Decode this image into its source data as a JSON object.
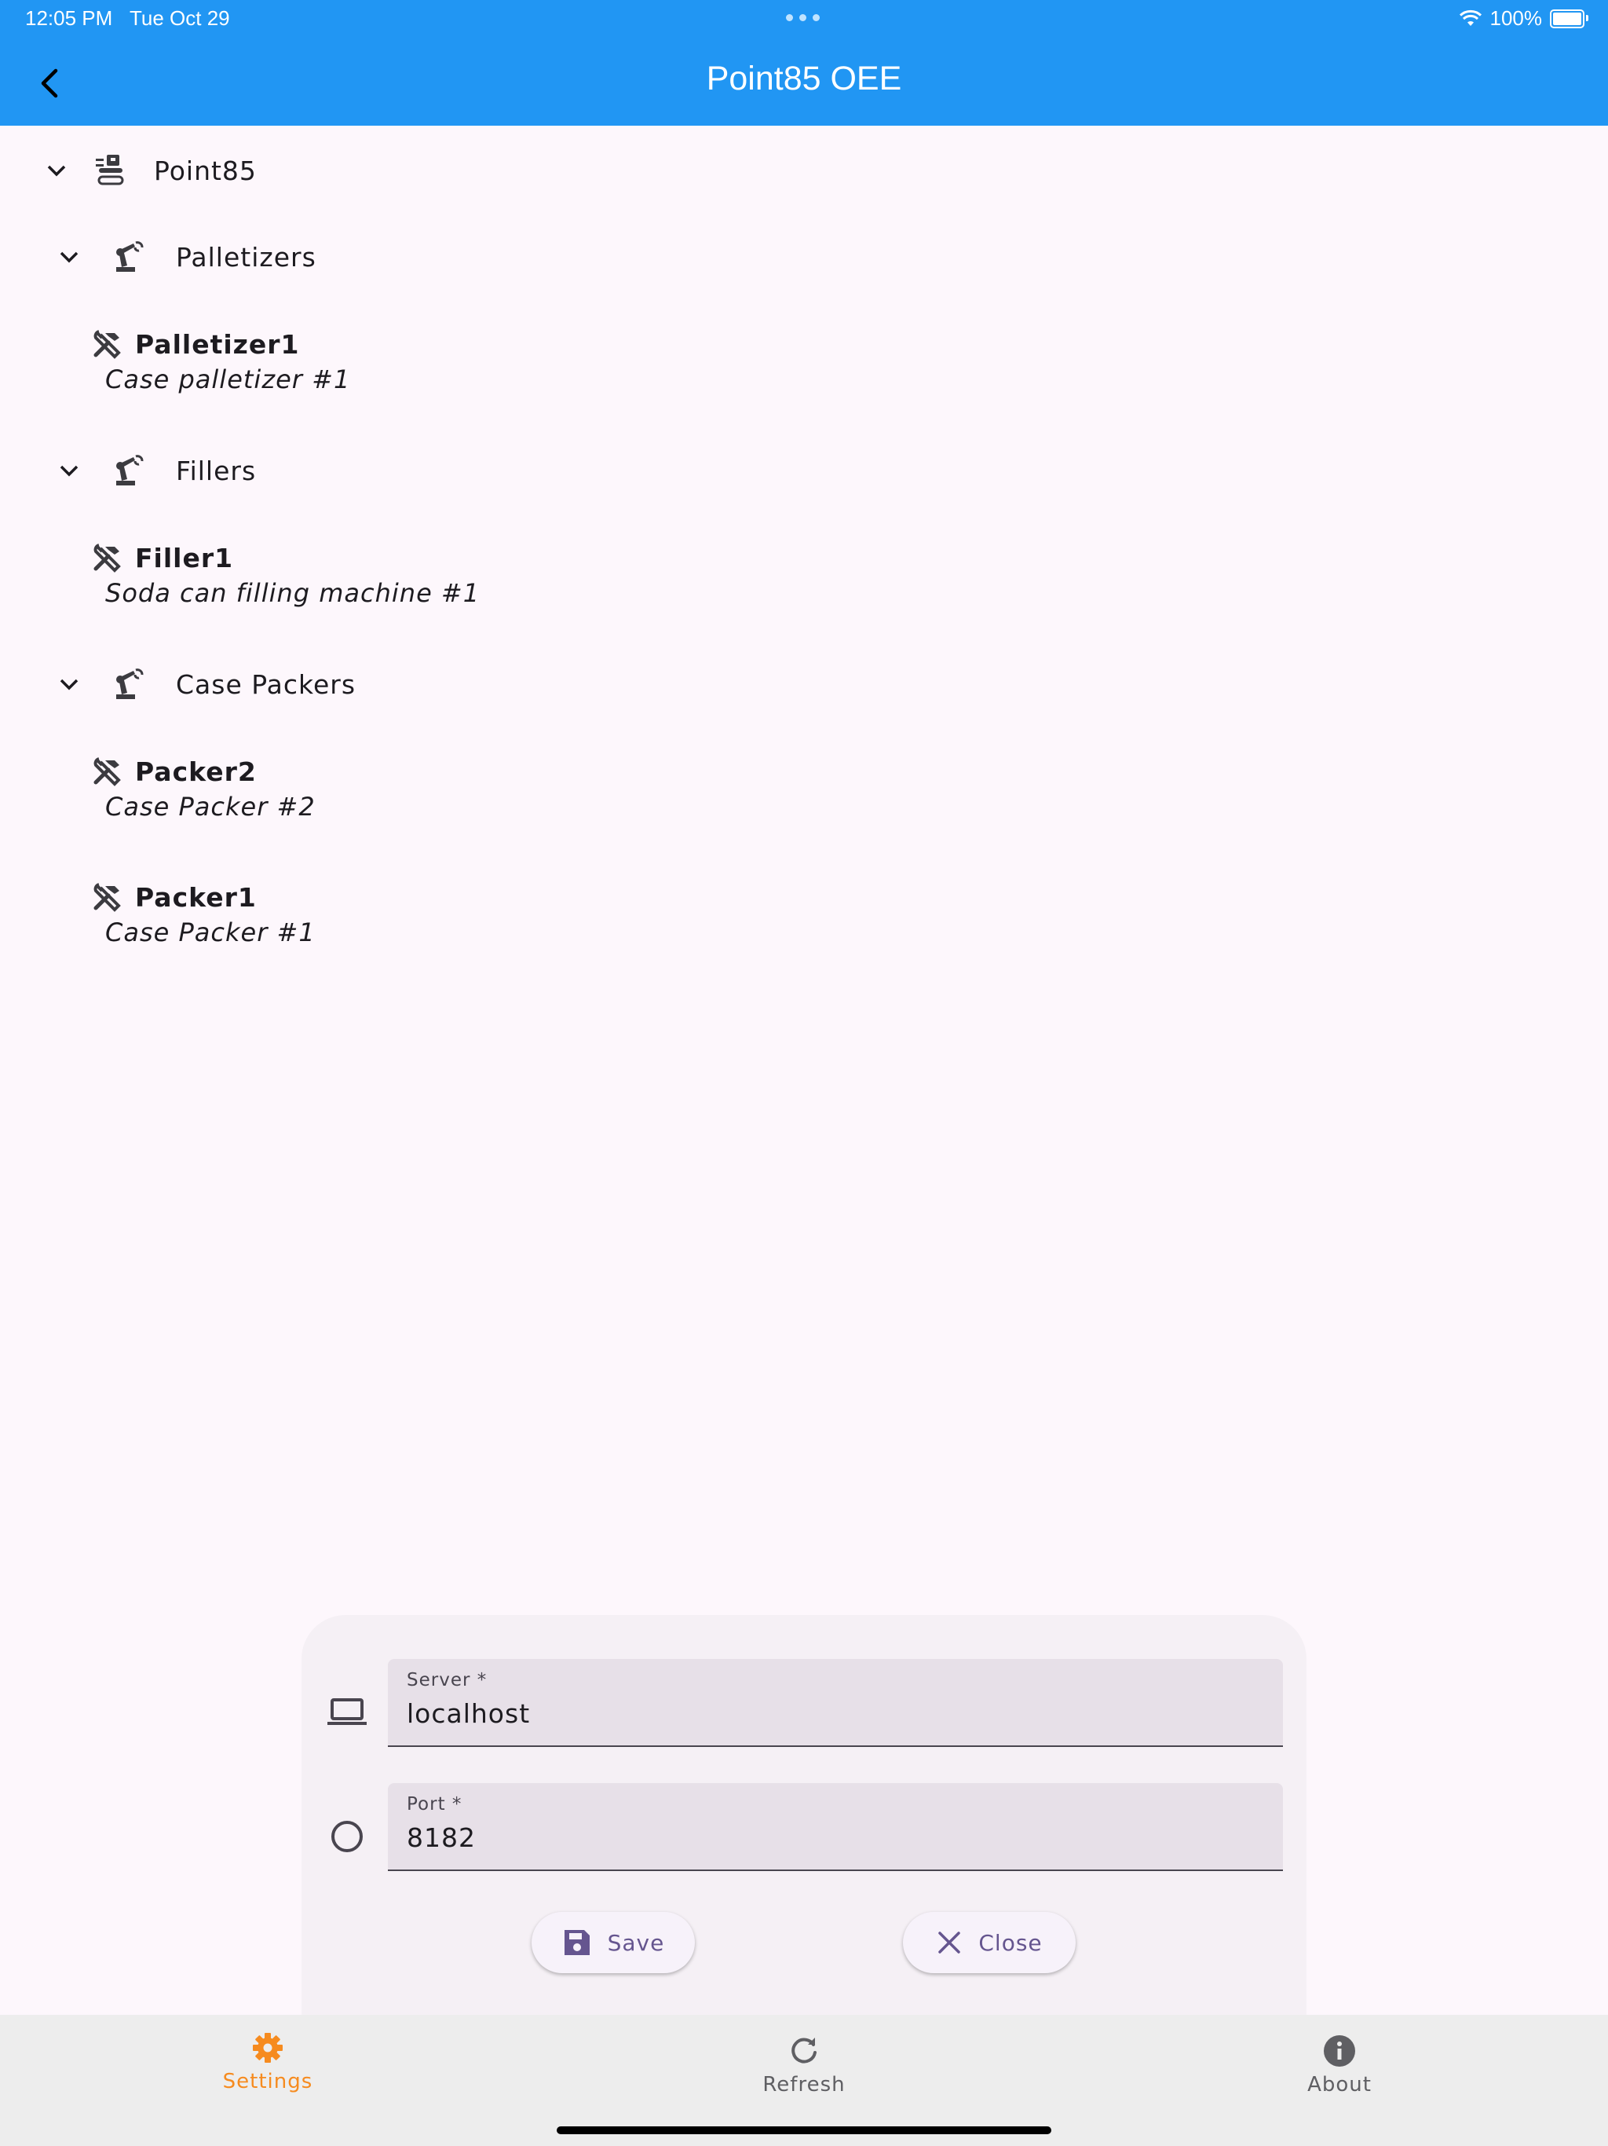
{
  "status_bar": {
    "time": "12:05 PM",
    "date": "Tue Oct 29",
    "battery": "100%"
  },
  "app_bar": {
    "title": "Point85 OEE"
  },
  "tree": {
    "root": {
      "label": "Point85",
      "icon": "production-line-icon"
    },
    "groups": [
      {
        "label": "Palletizers",
        "icon": "robot-arm-icon",
        "items": [
          {
            "name": "Palletizer1",
            "description": "Case palletizer #1"
          }
        ]
      },
      {
        "label": "Fillers",
        "icon": "robot-arm-icon",
        "items": [
          {
            "name": "Filler1",
            "description": "Soda can filling machine #1"
          }
        ]
      },
      {
        "label": "Case Packers",
        "icon": "robot-arm-icon",
        "items": [
          {
            "name": "Packer2",
            "description": "Case Packer #2"
          },
          {
            "name": "Packer1",
            "description": "Case Packer #1"
          }
        ]
      }
    ]
  },
  "settings_sheet": {
    "server": {
      "label": "Server *",
      "value": "localhost",
      "icon": "laptop-icon"
    },
    "port": {
      "label": "Port *",
      "value": "8182",
      "icon": "circle-icon"
    },
    "save_label": "Save",
    "close_label": "Close"
  },
  "bottom_nav": {
    "items": [
      {
        "label": "Settings",
        "icon": "gear-icon",
        "active": true
      },
      {
        "label": "Refresh",
        "icon": "refresh-icon",
        "active": false
      },
      {
        "label": "About",
        "icon": "info-icon",
        "active": false
      }
    ]
  },
  "colors": {
    "primary": "#2196f3",
    "active_nav": "#f68b1f",
    "button_text": "#65558f",
    "background": "#fdf7fc"
  }
}
